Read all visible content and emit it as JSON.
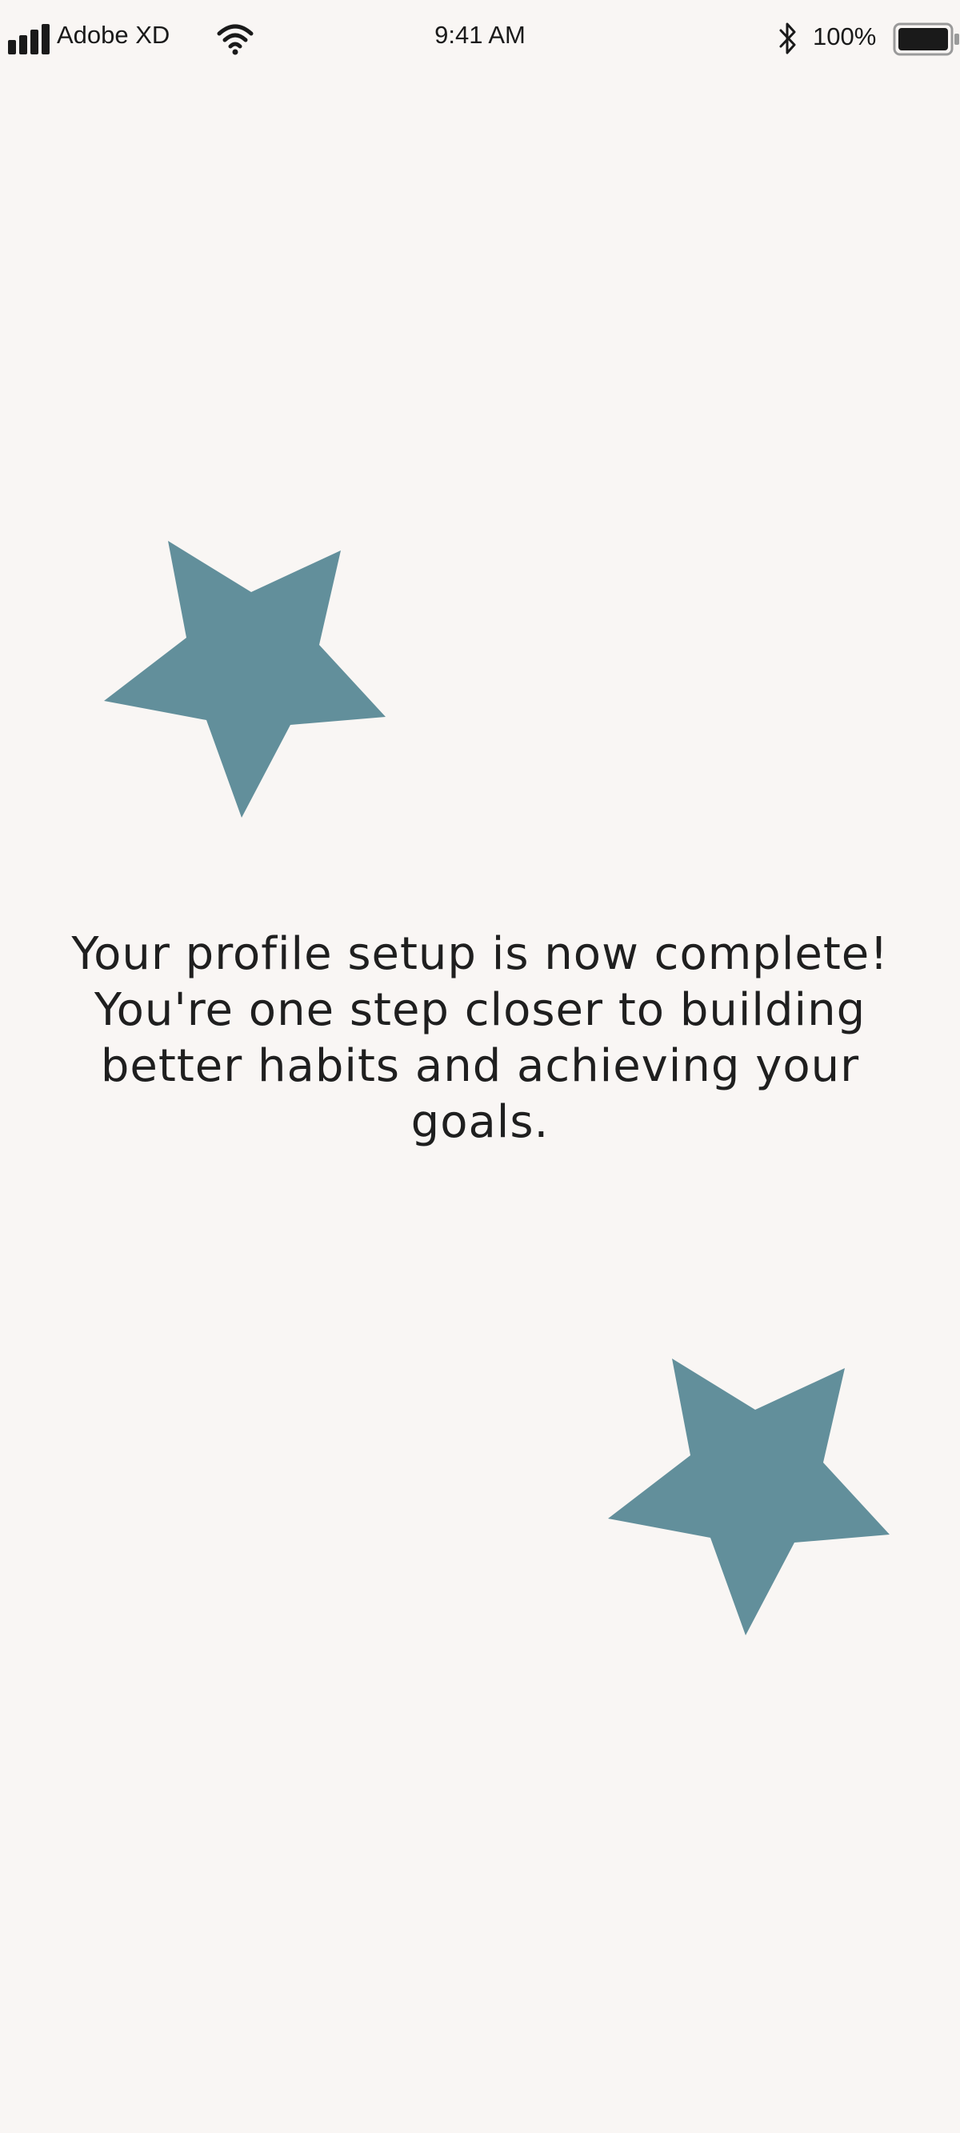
{
  "status_bar": {
    "carrier": "Adobe XD",
    "time": "9:41 AM",
    "battery_percent": "100%",
    "battery_level": 1.0,
    "icons": [
      "signal-icon",
      "wifi-icon",
      "bluetooth-icon",
      "battery-icon"
    ]
  },
  "message": {
    "line1": "Your profile setup is now complete!",
    "line2": "You're one step closer to building better habits and achieving your goals."
  },
  "decorations": {
    "star_color": "#628f9b",
    "icons": [
      "star-icon",
      "star-icon"
    ]
  },
  "colors": {
    "background": "#f9f6f4",
    "text": "#1f1f1f",
    "accent": "#628f9b"
  }
}
